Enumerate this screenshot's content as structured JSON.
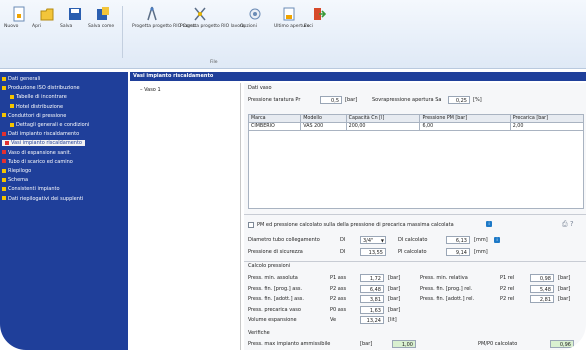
{
  "ribbon": {
    "buttons": [
      {
        "label": "Nuovo",
        "icon": "new-doc-icon"
      },
      {
        "label": "Apri",
        "icon": "open-folder-icon"
      },
      {
        "label": "Salva",
        "icon": "save-icon"
      },
      {
        "label": "Salva come",
        "icon": "save-as-icon"
      },
      {
        "label": "Progetta progetto RIO Corso",
        "icon": "design-compass-icon"
      },
      {
        "label": "Progetta progetto RIO lavoro",
        "icon": "design-tool-icon"
      },
      {
        "label": "Opzioni",
        "icon": "options-icon"
      },
      {
        "label": "Ultimo aperture",
        "icon": "recent-icon"
      },
      {
        "label": "Esci",
        "icon": "exit-icon"
      }
    ],
    "group_label": "File"
  },
  "sidebar": {
    "items": [
      {
        "label": "Dati generali",
        "level": 0,
        "color": "#f5c400"
      },
      {
        "label": "Produzione ISO distribuzione",
        "level": 0,
        "color": "#f5c400"
      },
      {
        "label": "Tabelle di incontrare",
        "level": 1,
        "color": "#f5c400"
      },
      {
        "label": "Hotel distribuzione",
        "level": 1,
        "color": "#f5c400"
      },
      {
        "label": "Conduttori di pressione",
        "level": 0,
        "color": "#f5c400"
      },
      {
        "label": "Dettagli generali e condizioni",
        "level": 1,
        "color": "#f5c400"
      },
      {
        "label": "Dati impianto riscaldamento",
        "level": 0,
        "color": "#e23030"
      },
      {
        "label": "Vasi impianto riscaldamento",
        "level": 0,
        "color": "#e23030",
        "selected": true
      },
      {
        "label": "Vaso di espansione sanit.",
        "level": 0,
        "color": "#e23030"
      },
      {
        "label": "Tubo di scarico ed camino",
        "level": 0,
        "color": "#e23030"
      },
      {
        "label": "Riepilogo",
        "level": 0,
        "color": "#f5c400"
      },
      {
        "label": "Schema",
        "level": 0,
        "color": "#f5c400"
      },
      {
        "label": "Consistenti impianto",
        "level": 0,
        "color": "#f5c400"
      },
      {
        "label": "Dati riepilogativi dei supplenti",
        "level": 0,
        "color": "#f5c400"
      }
    ]
  },
  "title": "Vasi impianto riscaldamento",
  "tree": {
    "node": "Vaso 1"
  },
  "vaso": {
    "section_label": "Dati vaso",
    "precarica_label": "Pressione taratura Pr",
    "precarica_value": "0,5",
    "precarica_unit": "[bar]",
    "apertura_label": "Sovrapressione apertura Sa",
    "apertura_value": "0,25",
    "apertura_unit": "[%]"
  },
  "table": {
    "headers": [
      "Marca",
      "Modello",
      "Capacità Cn [l]",
      "Pressione PM [bar]",
      "Precarica [bar]"
    ],
    "rows": [
      [
        "CIMBERIO",
        "VAS 200",
        "200,00",
        "6,00",
        "2,00"
      ]
    ]
  },
  "option": {
    "checkbox_label": "PM ed pressione calcolato sulla della pressione di precarica massima calcolata"
  },
  "calc": {
    "diam_label": "Diametro tubo collegamento",
    "diam_sym": "DI",
    "diam_select": "3/4\"",
    "diam_calc_label": "DI calcolato",
    "diam_calc_value": "6,13",
    "diam_unit": "[mm]",
    "temp_label": "Pressione di sicurezza",
    "temp_sym": "DI",
    "temp_value": "13,55",
    "temp_calc_label": "PI calcolato",
    "temp_calc_value": "9,14",
    "temp_unit": "[mm]"
  },
  "pressioni": {
    "section_label": "Calcolo pressioni",
    "left": [
      {
        "label": "Press. min. assoluta",
        "sym": "P1 ass",
        "value": "1,72",
        "unit": "[bar]"
      },
      {
        "label": "Press. fin. [prog.] ass.",
        "sym": "P2 ass",
        "value": "6,48",
        "unit": "[bar]"
      },
      {
        "label": "Press. fin. [adott.] ass.",
        "sym": "P2 ass",
        "value": "3,81",
        "unit": "[bar]"
      },
      {
        "label": "Press. precarica vaso",
        "sym": "P0 ass",
        "value": "1,63",
        "unit": "[bar]"
      },
      {
        "label": "Volume espansione",
        "sym": "Ve",
        "value": "13,24",
        "unit": "[lit]"
      }
    ],
    "right": [
      {
        "label": "Press. min. relativa",
        "sym": "P1 rel",
        "value": "0,98",
        "unit": "[bar]"
      },
      {
        "label": "Press. fin. [prog.] rel.",
        "sym": "P2 rel",
        "value": "5,48",
        "unit": "[bar]"
      },
      {
        "label": "Press. fin. [adott.] rel.",
        "sym": "P2 rel",
        "value": "2,81",
        "unit": "[bar]"
      }
    ]
  },
  "verifica": {
    "section_label": "Verifiche",
    "row_label": "Press. max impianto ammissibile",
    "row_unit": "[bar]",
    "row_value": "1,00",
    "right_label": "PM/P0 calcolato",
    "right_value": "0,96"
  }
}
